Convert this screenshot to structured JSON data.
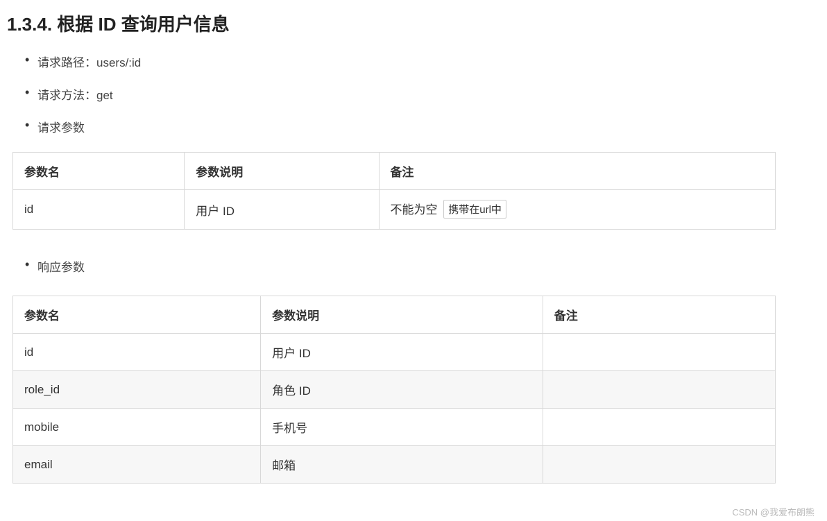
{
  "heading": "1.3.4. 根据 ID 查询用户信息",
  "bullets_top": [
    "请求路径：users/:id",
    "请求方法：get",
    "请求参数"
  ],
  "req_table": {
    "headers": [
      "参数名",
      "参数说明",
      "备注"
    ],
    "rows": [
      {
        "name": "id",
        "desc": "用户 ID",
        "remark_text": "不能为空",
        "remark_badge": "携带在url中"
      }
    ]
  },
  "bullets_mid": [
    "响应参数"
  ],
  "res_table": {
    "headers": [
      "参数名",
      "参数说明",
      "备注"
    ],
    "rows": [
      {
        "name": "id",
        "desc": "用户 ID",
        "remark": ""
      },
      {
        "name": "role_id",
        "desc": "角色 ID",
        "remark": ""
      },
      {
        "name": "mobile",
        "desc": "手机号",
        "remark": ""
      },
      {
        "name": "email",
        "desc": "邮箱",
        "remark": ""
      }
    ]
  },
  "watermark": "CSDN @我爱布朗熊"
}
